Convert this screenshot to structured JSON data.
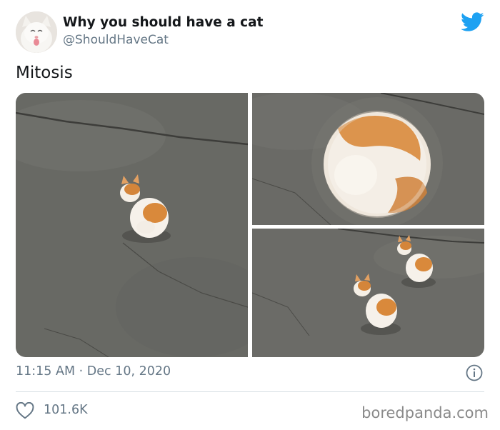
{
  "tweet": {
    "display_name": "Why you should have a cat",
    "handle": "@ShouldHaveCat",
    "text": "Mitosis",
    "timestamp": "11:15 AM · Dec 10, 2020",
    "likes": "101.6K"
  },
  "icons": {
    "brand": "twitter-bird-icon",
    "info": "info-icon",
    "like": "heart-icon"
  },
  "colors": {
    "twitter_blue": "#1da1f2",
    "secondary_text": "#657786",
    "pavement": "#6b6b67",
    "kitten_orange": "#d98a3c"
  },
  "watermark": "boredpanda.com"
}
